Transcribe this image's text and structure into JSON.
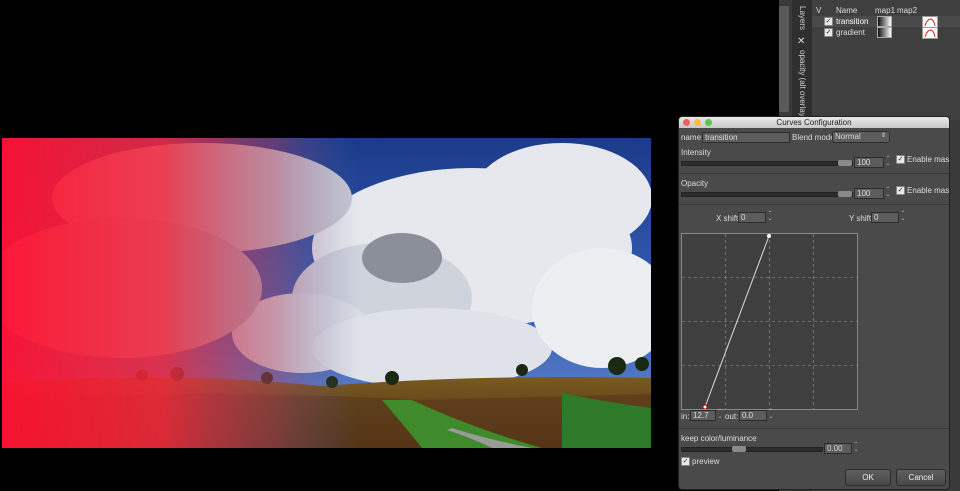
{
  "layers_panel": {
    "tabs": [
      "Layers",
      "opacity (alt overlay)"
    ],
    "headers": {
      "v": "V",
      "name": "Name",
      "map1": "map1",
      "map2": "map2"
    },
    "rows": [
      {
        "name": "transition",
        "checked": "✓"
      },
      {
        "name": "gradient",
        "checked": "✓"
      }
    ],
    "close_glyph": "✕"
  },
  "dialog": {
    "title": "Curves Configuration",
    "name_label": "name:",
    "name_value": "transition",
    "blend_label": "Blend mode:",
    "blend_value": "Normal",
    "intensity_label": "Intensity",
    "intensity_value": "100",
    "intensity_level": 1.0,
    "opacity_label": "Opacity",
    "opacity_value": "100",
    "opacity_level": 1.0,
    "enable_mask_label": "Enable mask",
    "x_shift_label": "X shift",
    "x_shift_value": "0",
    "y_shift_label": "Y shift",
    "y_shift_value": "0",
    "in_label": "in:",
    "in_value": "12.7",
    "out_label": "out:",
    "out_value": "0.0",
    "keep_label": "keep color/luminance",
    "keep_value": "0.00",
    "keep_level": 0.4,
    "preview_label": "preview",
    "ok_label": "OK",
    "cancel_label": "Cancel",
    "colors": {
      "close": "#f25f58",
      "minimize": "#f9be3e",
      "zoom": "#58c94d"
    }
  }
}
